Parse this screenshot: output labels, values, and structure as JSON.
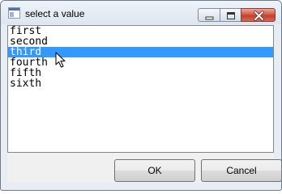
{
  "window": {
    "title": "select a value",
    "icon": "app-window-icon",
    "controls": [
      "minimize-icon",
      "maximize-icon",
      "close-icon"
    ]
  },
  "listbox": {
    "items": [
      "first",
      "second",
      "third",
      "fourth",
      "fifth",
      "sixth"
    ],
    "selected_index": 2
  },
  "buttons": {
    "ok_label": "OK",
    "cancel_label": "Cancel"
  },
  "colors": {
    "selection": "#3399ff",
    "close_button": "#c94f3b"
  }
}
